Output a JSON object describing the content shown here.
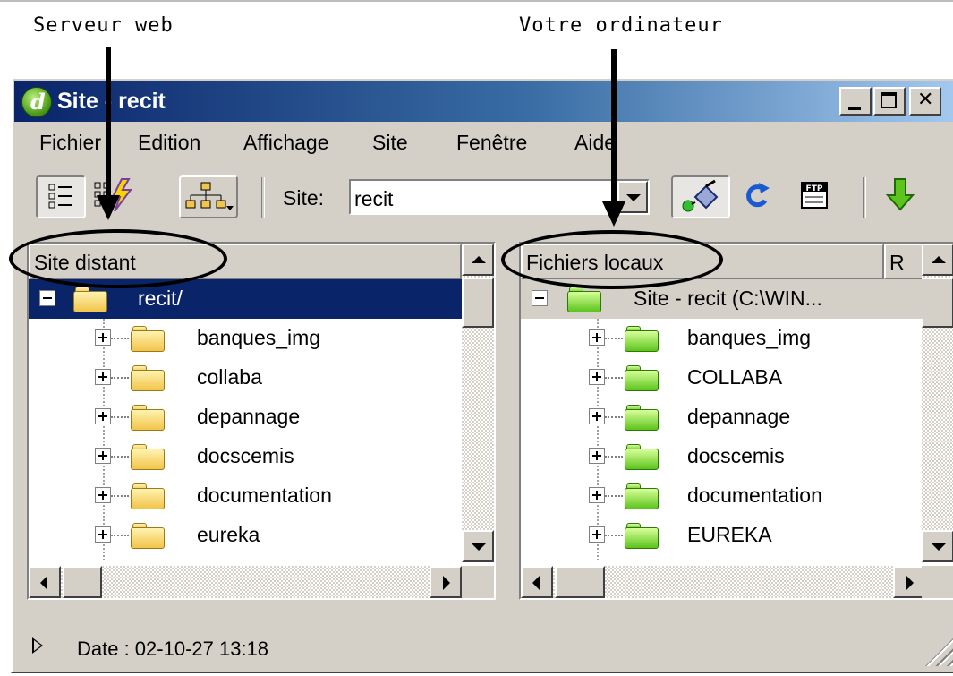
{
  "annotations": {
    "left_caption": "Serveur web",
    "right_caption": "Votre ordinateur"
  },
  "window": {
    "title": "Site - recit",
    "controls": [
      "minimize-icon",
      "maximize-icon",
      "close-icon"
    ]
  },
  "menu": [
    "Fichier",
    "Edition",
    "Affichage",
    "Site",
    "Fenêtre",
    "Aide"
  ],
  "toolbar": {
    "view_buttons": [
      "file-view-icon",
      "site-files-icon",
      "site-map-icon"
    ],
    "site_label": "Site:",
    "site_value": "recit",
    "actions": [
      "connect-icon",
      "refresh-icon",
      "ftp-log-icon",
      "get-files-icon"
    ]
  },
  "remote": {
    "header": "Site distant",
    "root": "recit/",
    "items": [
      "banques_img",
      "collaba",
      "depannage",
      "docscemis",
      "documentation",
      "eureka"
    ]
  },
  "local": {
    "header": "Fichiers locaux",
    "header2": "R",
    "root": "Site - recit (C:\\WIN...",
    "items": [
      "banques_img",
      "COLLABA",
      "depannage",
      "docscemis",
      "documentation",
      "EUREKA"
    ]
  },
  "status": {
    "text": "Date : 02-10-27 13:18"
  },
  "colors": {
    "title_bar": "#0a246a",
    "selection": "#0a246a",
    "face": "#d4d0c8"
  }
}
